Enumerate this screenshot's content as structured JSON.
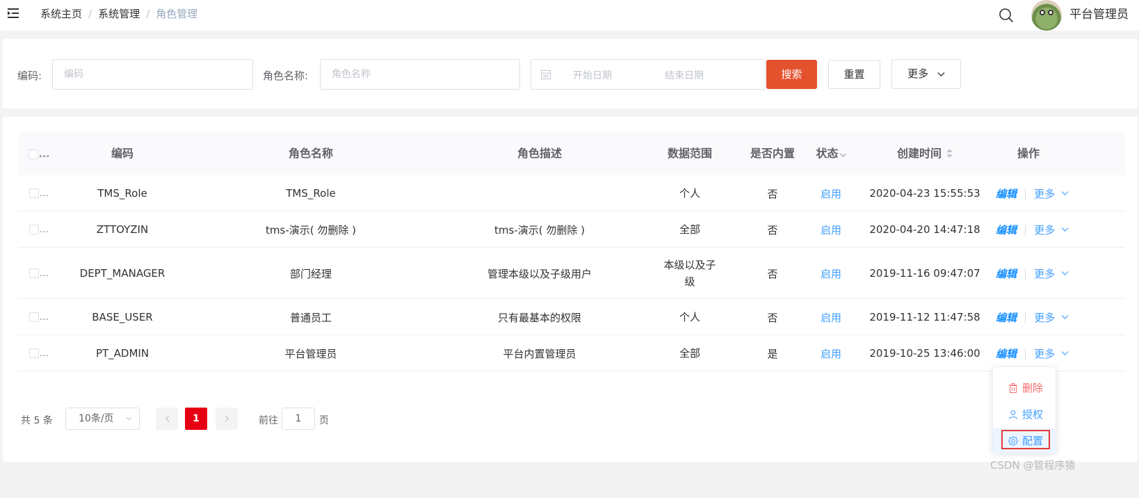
{
  "breadcrumb": {
    "home": "系统主页",
    "section": "系统管理",
    "current": "角色管理",
    "separator": "/"
  },
  "header": {
    "username": "平台管理员"
  },
  "filters": {
    "code_label": "编码:",
    "code_placeholder": "编码",
    "name_label": "角色名称:",
    "name_placeholder": "角色名称",
    "start_date_placeholder": "开始日期",
    "end_date_placeholder": "结束日期",
    "search_label": "搜索",
    "reset_label": "重置",
    "more_label": "更多"
  },
  "table": {
    "columns": {
      "select": "...",
      "code": "编码",
      "name": "角色名称",
      "desc": "角色描述",
      "scope": "数据范围",
      "builtin": "是否内置",
      "status": "状态",
      "created": "创建时间",
      "actions": "操作"
    },
    "rows": [
      {
        "code": "TMS_Role",
        "name": "TMS_Role",
        "desc": "",
        "scope": "个人",
        "builtin": "否",
        "status": "启用",
        "created": "2020-04-23 15:55:53"
      },
      {
        "code": "ZTTOYZIN",
        "name": "tms-演示( 勿删除 )",
        "desc": "tms-演示( 勿删除 )",
        "scope": "全部",
        "builtin": "否",
        "status": "启用",
        "created": "2020-04-20 14:47:18"
      },
      {
        "code": "DEPT_MANAGER",
        "name": "部门经理",
        "desc": "管理本级以及子级用户",
        "scope": "本级以及子级",
        "builtin": "否",
        "status": "启用",
        "created": "2019-11-16 09:47:07"
      },
      {
        "code": "BASE_USER",
        "name": "普通员工",
        "desc": "只有最基本的权限",
        "scope": "个人",
        "builtin": "否",
        "status": "启用",
        "created": "2019-11-12 11:47:58"
      },
      {
        "code": "PT_ADMIN",
        "name": "平台管理员",
        "desc": "平台内置管理员",
        "scope": "全部",
        "builtin": "是",
        "status": "启用",
        "created": "2019-10-25 13:46:00"
      }
    ],
    "actions": {
      "edit": "编辑",
      "sep": "|",
      "more": "更多"
    }
  },
  "pagination": {
    "total": "共 5 条",
    "page_size": "10条/页",
    "current_page": "1",
    "goto_prefix": "前往",
    "goto_value": "1",
    "goto_suffix": "页"
  },
  "dropdown": {
    "delete": "删除",
    "authorize": "授权",
    "configure": "配置"
  },
  "watermark": "CSDN @管程序猿",
  "colors": {
    "primary": "#e4512d",
    "link": "#409eff",
    "active_page": "#e60012",
    "danger": "#f56c6c",
    "highlight_frame": "#e4393c"
  }
}
